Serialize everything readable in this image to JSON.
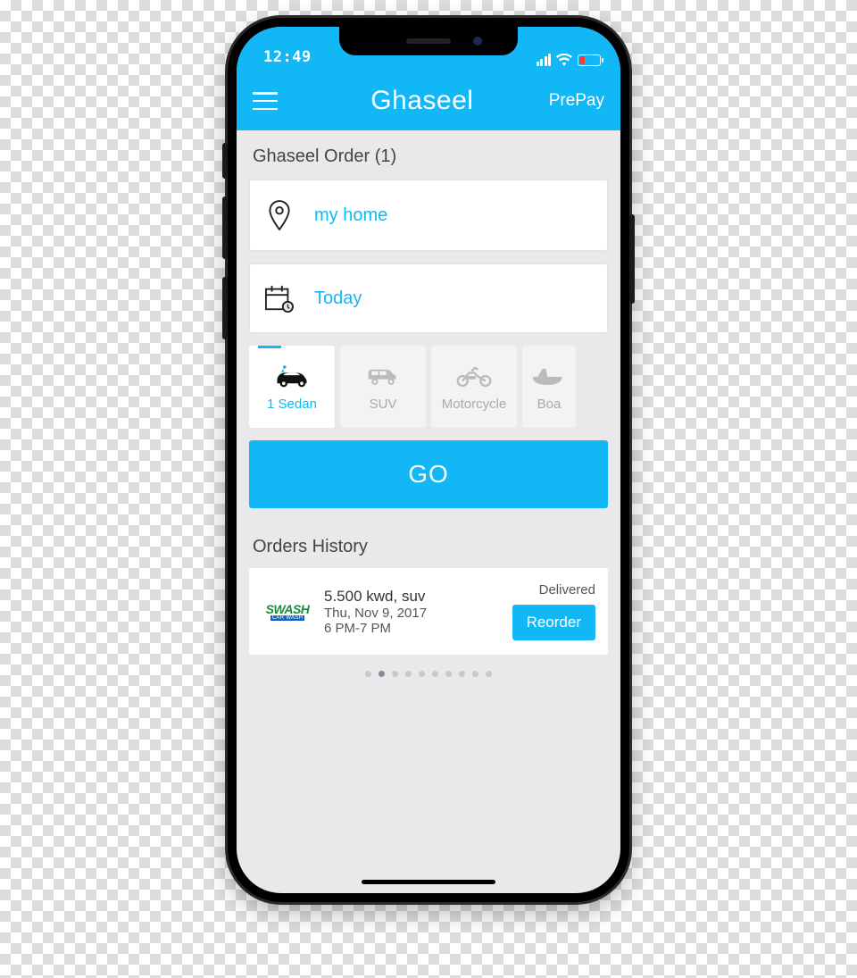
{
  "statusbar": {
    "time": "12:49"
  },
  "navbar": {
    "title": "Ghaseel",
    "right_action": "PrePay"
  },
  "order_section": {
    "title": "Ghaseel Order (1)",
    "location_label": "my home",
    "date_label": "Today"
  },
  "vehicles": [
    {
      "label": "1 Sedan",
      "active": true
    },
    {
      "label": "SUV",
      "active": false
    },
    {
      "label": "Motorcycle",
      "active": false
    },
    {
      "label": "Boa",
      "active": false
    }
  ],
  "go_button": "GO",
  "history": {
    "title": "Orders History",
    "item": {
      "vendor_line1": "SWASH",
      "vendor_line2": "CAR WASH",
      "summary": "5.500 kwd, suv",
      "date": "Thu, Nov 9, 2017",
      "timeslot": "6 PM-7 PM",
      "status": "Delivered",
      "reorder_label": "Reorder"
    },
    "page_count": 10,
    "active_page": 2
  },
  "colors": {
    "accent": "#12b7f5"
  }
}
